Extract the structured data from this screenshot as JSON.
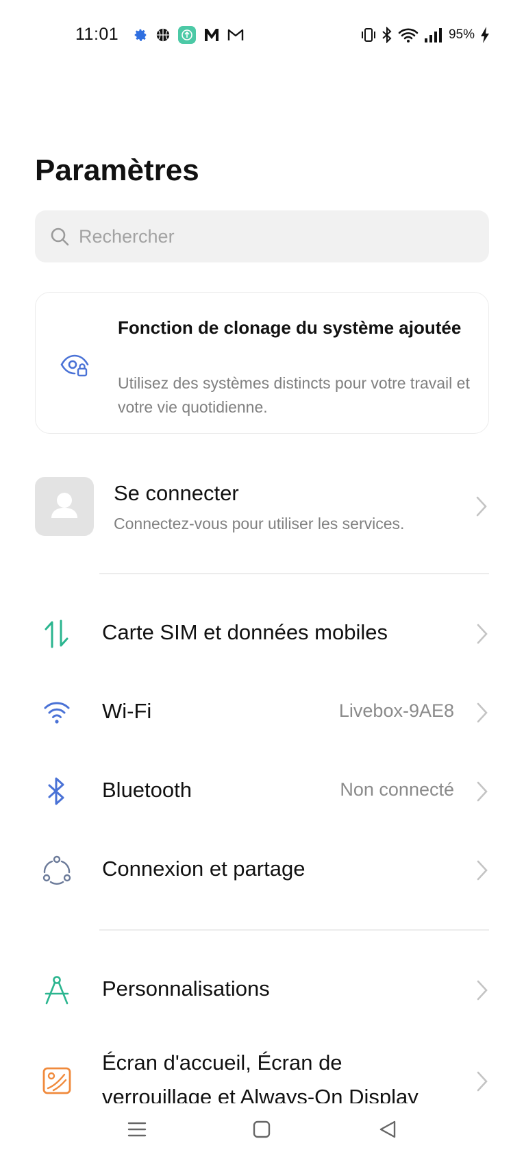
{
  "status_bar": {
    "time": "11:01",
    "battery": "95%",
    "left_icons": [
      "gear-icon",
      "basketball-icon",
      "upload-app-icon",
      "m-logo-icon",
      "gmail-icon"
    ],
    "right_icons": [
      "vibrate-icon",
      "bluetooth-icon",
      "wifi-icon",
      "signal-icon",
      "charging-icon"
    ]
  },
  "page": {
    "title": "Paramètres"
  },
  "search": {
    "placeholder": "Rechercher"
  },
  "promo": {
    "title": "Fonction de clonage du système ajoutée",
    "description": "Utilisez des systèmes distincts pour votre travail et votre vie quotidienne.",
    "icon": "clone-eye-icon"
  },
  "account": {
    "name": "Se connecter",
    "subtitle": "Connectez-vous pour utiliser les services."
  },
  "settings": [
    {
      "label": "Carte SIM et données mobiles",
      "value": "",
      "icon": "sim-data-icon",
      "color": "#2bb58f"
    },
    {
      "label": "Wi-Fi",
      "value": "Livebox-9AE8",
      "icon": "wifi-icon",
      "color": "#4a72d6"
    },
    {
      "label": "Bluetooth",
      "value": "Non connecté",
      "icon": "bluetooth-icon",
      "color": "#4a72d6"
    },
    {
      "label": "Connexion et partage",
      "value": "",
      "icon": "connection-share-icon",
      "color": "#6b7a99"
    },
    {
      "label": "Personnalisations",
      "value": "",
      "icon": "compass-icon",
      "color": "#2bb58f"
    },
    {
      "label": "Écran d'accueil, Écran de verrouillage et Always-On Display",
      "value": "",
      "icon": "wallpaper-icon",
      "color": "#f08a3c"
    }
  ],
  "nav": {
    "icons": [
      "menu-icon",
      "home-icon",
      "back-icon"
    ]
  }
}
